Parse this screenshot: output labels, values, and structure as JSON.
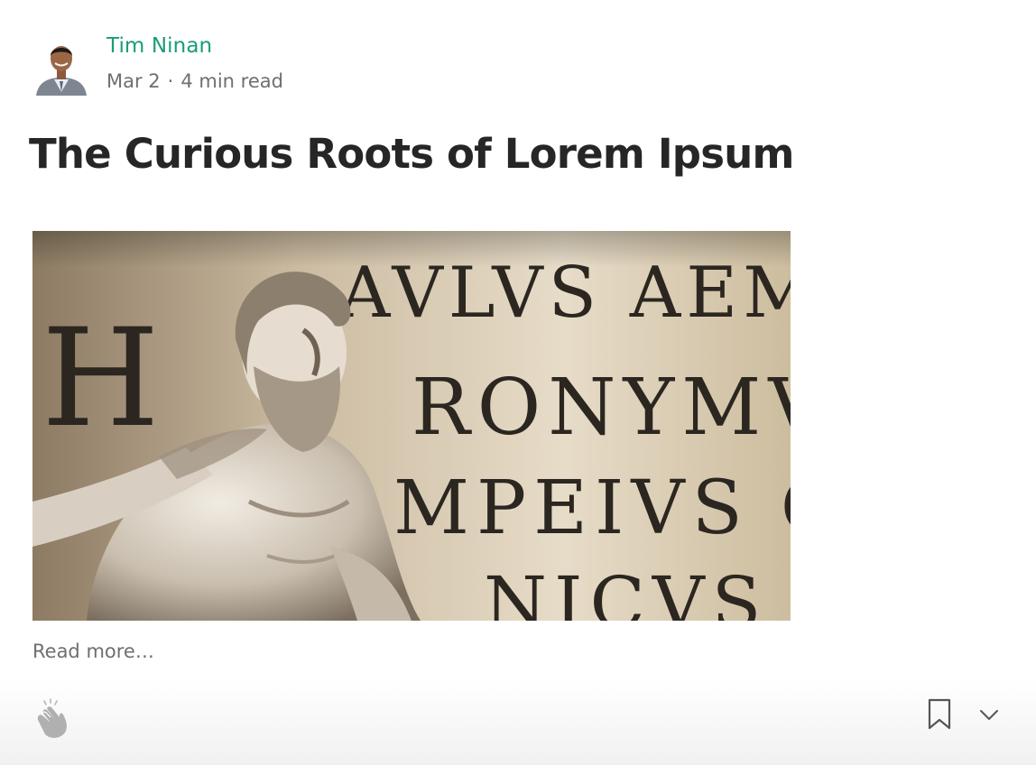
{
  "post": {
    "author": "Tim Ninan",
    "date": "Mar 2",
    "separator": "·",
    "read_time": "4 min read",
    "title": "The Curious Roots of Lorem Ipsum",
    "read_more": "Read more…"
  },
  "hero": {
    "inscription": {
      "line1": "AVLVS  AEMILIVS",
      "line2": "RONYMVS",
      "line3": "MPEIVS CA",
      "line4": "NICVS DE",
      "left_letters": "H"
    }
  },
  "icons": {
    "avatar": "avatar-icon",
    "clap": "clap-icon",
    "bookmark": "bookmark-icon",
    "more": "chevron-down-icon"
  },
  "colors": {
    "author_link": "#1a9c78",
    "title": "#262626",
    "meta": "#6f6f6f"
  }
}
